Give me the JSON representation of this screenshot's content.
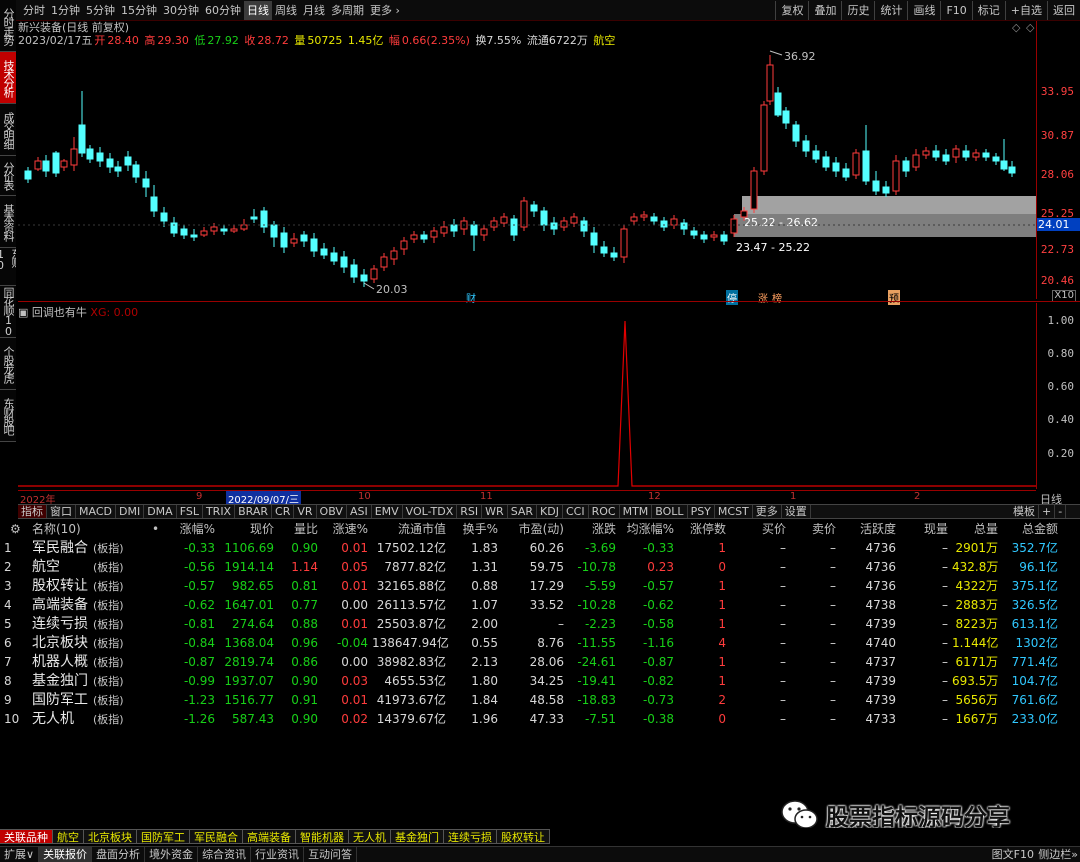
{
  "period_bar": {
    "left": [
      "分时",
      "1分钟",
      "5分钟",
      "15分钟",
      "30分钟",
      "60分钟",
      "日线",
      "周线",
      "月线",
      "多周期",
      "更多 ›"
    ],
    "active_index": 6,
    "right": [
      "复权",
      "叠加",
      "历史",
      "统计",
      "画线",
      "F10",
      "标记",
      "+自选",
      "返回"
    ]
  },
  "side_tabs": [
    {
      "label": "分时走势",
      "active": false
    },
    {
      "label": "技术分析",
      "active": true
    },
    {
      "label": "成交明细",
      "active": false
    },
    {
      "label": "分价表",
      "active": false
    },
    {
      "label": "基本资料",
      "active": false
    },
    {
      "label": "东财10",
      "active": false
    },
    {
      "label": "同花顺10",
      "active": false
    },
    {
      "label": "个股龙虎",
      "active": false
    },
    {
      "label": "东财股吧",
      "active": false
    }
  ],
  "kline_info": {
    "title": "新兴装备(日线 前复权)",
    "date": "2023/02/17五",
    "open_label": "开",
    "open": "28.40",
    "high_label": "高",
    "high": "29.30",
    "low_label": "低",
    "low": "27.92",
    "close_label": "收",
    "close": "28.72",
    "vol_label": "量",
    "vol": "50725",
    "amount": "1.45亿",
    "change_label": "幅",
    "change": "0.66(2.35%)",
    "turnover": "换7.55%",
    "float": "流通6722万",
    "sector": "航空"
  },
  "price_axis": {
    "labels": [
      "33.95",
      "30.87",
      "28.06",
      "25.25",
      "22.73",
      "20.46"
    ],
    "current": "24.01",
    "zoom": "X10"
  },
  "main_chart": {
    "high_mark": "36.92",
    "low_mark": "20.03",
    "zone1": "25.22 - 26.62",
    "zone2": "23.47 - 25.22",
    "markers": [
      "财",
      "停",
      "涨",
      "榜",
      "预"
    ]
  },
  "sub_chart": {
    "name": "回调也有牛",
    "value_label": "XG: 0.00",
    "axis": [
      "1.00",
      "0.80",
      "0.60",
      "0.40",
      "0.20"
    ]
  },
  "date_axis": [
    "2022年",
    "9",
    "2022/09/07/三",
    "10",
    "11",
    "12",
    "1",
    "2"
  ],
  "indicator_tabs": [
    "指标",
    "窗口",
    "MACD",
    "DMI",
    "DMA",
    "FSL",
    "TRIX",
    "BRAR",
    "CR",
    "VR",
    "OBV",
    "ASI",
    "EMV",
    "VOL-TDX",
    "RSI",
    "WR",
    "SAR",
    "KDJ",
    "CCI",
    "ROC",
    "MTM",
    "BOLL",
    "PSY",
    "MCST",
    "更多",
    "设置"
  ],
  "indicator_right": [
    "模板",
    "+",
    "-"
  ],
  "table": {
    "headers": [
      "名称(10)",
      "•",
      "涨幅%",
      "现价",
      "量比",
      "涨速%",
      "流通市值",
      "换手%",
      "市盈(动)",
      "涨跌",
      "均涨幅%",
      "涨停数",
      "买价",
      "卖价",
      "活跃度",
      "现量",
      "总量",
      "总金额"
    ],
    "rows": [
      {
        "i": "1",
        "name": "军民融合",
        "tag": "(板指)",
        "chg": "-0.33",
        "price": "1106.69",
        "vr": "0.90",
        "speed": "0.01",
        "mv": "17502.12亿",
        "turn": "1.83",
        "pe": "60.26",
        "diff": "-3.69",
        "avg": "-0.33",
        "lim": "1",
        "buy": "–",
        "sell": "–",
        "act": "4736",
        "cur": "–",
        "vol": "2901万",
        "amt": "352.7亿"
      },
      {
        "i": "2",
        "name": "航空",
        "tag": "(板指)",
        "chg": "-0.56",
        "price": "1914.14",
        "vr": "1.14",
        "speed": "0.05",
        "mv": "7877.82亿",
        "turn": "1.31",
        "pe": "59.75",
        "diff": "-10.78",
        "avg": "0.23",
        "lim": "0",
        "buy": "–",
        "sell": "–",
        "act": "4736",
        "cur": "–",
        "vol": "432.8万",
        "amt": "96.1亿"
      },
      {
        "i": "3",
        "name": "股权转让",
        "tag": "(板指)",
        "chg": "-0.57",
        "price": "982.65",
        "vr": "0.81",
        "speed": "0.01",
        "mv": "32165.88亿",
        "turn": "0.88",
        "pe": "17.29",
        "diff": "-5.59",
        "avg": "-0.57",
        "lim": "1",
        "buy": "–",
        "sell": "–",
        "act": "4736",
        "cur": "–",
        "vol": "4322万",
        "amt": "375.1亿"
      },
      {
        "i": "4",
        "name": "高端装备",
        "tag": "(板指)",
        "chg": "-0.62",
        "price": "1647.01",
        "vr": "0.77",
        "speed": "0.00",
        "mv": "26113.57亿",
        "turn": "1.07",
        "pe": "33.52",
        "diff": "-10.28",
        "avg": "-0.62",
        "lim": "1",
        "buy": "–",
        "sell": "–",
        "act": "4738",
        "cur": "–",
        "vol": "2883万",
        "amt": "326.5亿"
      },
      {
        "i": "5",
        "name": "连续亏损",
        "tag": "(板指)",
        "chg": "-0.81",
        "price": "274.64",
        "vr": "0.88",
        "speed": "0.01",
        "mv": "25503.87亿",
        "turn": "2.00",
        "pe": "–",
        "diff": "-2.23",
        "avg": "-0.58",
        "lim": "1",
        "buy": "–",
        "sell": "–",
        "act": "4739",
        "cur": "–",
        "vol": "8223万",
        "amt": "613.1亿"
      },
      {
        "i": "6",
        "name": "北京板块",
        "tag": "(板指)",
        "chg": "-0.84",
        "price": "1368.04",
        "vr": "0.96",
        "speed": "-0.04",
        "mv": "138647.94亿",
        "turn": "0.55",
        "pe": "8.76",
        "diff": "-11.55",
        "avg": "-1.16",
        "lim": "4",
        "buy": "–",
        "sell": "–",
        "act": "4740",
        "cur": "–",
        "vol": "1.144亿",
        "amt": "1302亿"
      },
      {
        "i": "7",
        "name": "机器人概",
        "tag": "(板指)",
        "chg": "-0.87",
        "price": "2819.74",
        "vr": "0.86",
        "speed": "0.00",
        "mv": "38982.83亿",
        "turn": "2.13",
        "pe": "28.06",
        "diff": "-24.61",
        "avg": "-0.87",
        "lim": "1",
        "buy": "–",
        "sell": "–",
        "act": "4737",
        "cur": "–",
        "vol": "6171万",
        "amt": "771.4亿"
      },
      {
        "i": "8",
        "name": "基金独门",
        "tag": "(板指)",
        "chg": "-0.99",
        "price": "1937.07",
        "vr": "0.90",
        "speed": "0.03",
        "mv": "4655.53亿",
        "turn": "1.80",
        "pe": "34.25",
        "diff": "-19.41",
        "avg": "-0.82",
        "lim": "1",
        "buy": "–",
        "sell": "–",
        "act": "4739",
        "cur": "–",
        "vol": "693.5万",
        "amt": "104.7亿"
      },
      {
        "i": "9",
        "name": "国防军工",
        "tag": "(板指)",
        "chg": "-1.23",
        "price": "1516.77",
        "vr": "0.91",
        "speed": "0.01",
        "mv": "41973.67亿",
        "turn": "1.84",
        "pe": "48.58",
        "diff": "-18.83",
        "avg": "-0.73",
        "lim": "2",
        "buy": "–",
        "sell": "–",
        "act": "4739",
        "cur": "–",
        "vol": "5656万",
        "amt": "761.6亿"
      },
      {
        "i": "10",
        "name": "无人机",
        "tag": "(板指)",
        "chg": "-1.26",
        "price": "587.43",
        "vr": "0.90",
        "speed": "0.02",
        "mv": "14379.67亿",
        "turn": "1.96",
        "pe": "47.33",
        "diff": "-7.51",
        "avg": "-0.38",
        "lim": "0",
        "buy": "–",
        "sell": "–",
        "act": "4733",
        "cur": "–",
        "vol": "1667万",
        "amt": "233.0亿"
      }
    ]
  },
  "sector_tabs": [
    "关联品种",
    "航空",
    "北京板块",
    "国防军工",
    "军民融合",
    "高端装备",
    "智能机器",
    "无人机",
    "基金独门",
    "连续亏损",
    "股权转让"
  ],
  "bottom_bar": {
    "items": [
      "扩展∨",
      "关联报价",
      "盘面分析",
      "境外资金",
      "综合资讯",
      "行业资讯",
      "互动问答"
    ],
    "active_index": 1,
    "right": "图文F10",
    "right2": "侧边栏»"
  },
  "watermark": "股票指标源码分享",
  "colors": {
    "up": "#ff3c3c",
    "down": "#18d018",
    "bg": "#000000",
    "accent": "#c00000",
    "cyan": "#54ffff"
  }
}
